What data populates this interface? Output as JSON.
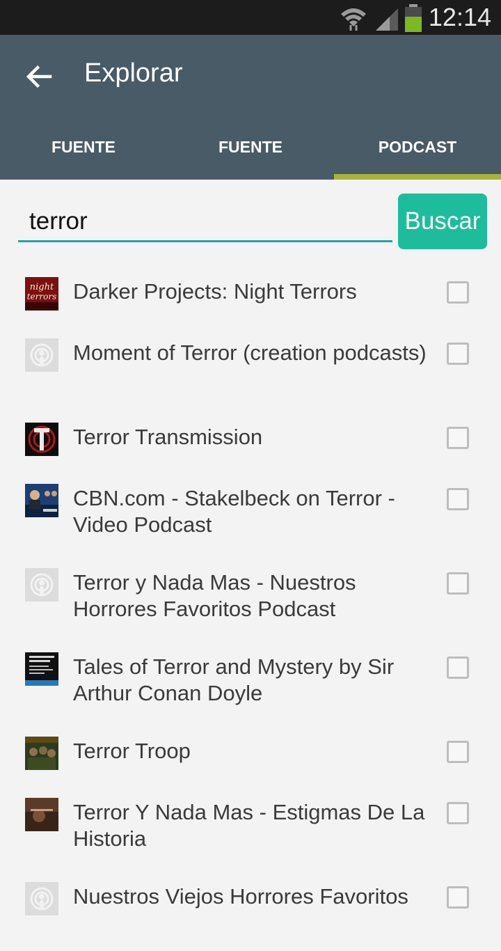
{
  "status_bar": {
    "time": "12:14"
  },
  "app_bar": {
    "title": "Explorar"
  },
  "tabs": [
    {
      "label": "FUENTE",
      "active": false
    },
    {
      "label": "FUENTE",
      "active": false
    },
    {
      "label": "PODCAST",
      "active": true
    }
  ],
  "search": {
    "value": "terror",
    "button_label": "Buscar"
  },
  "results": [
    {
      "title": "Darker Projects: Night Terrors",
      "thumb": "night-terrors-art",
      "checked": false
    },
    {
      "title": "Moment of Terror (creation podcasts)",
      "thumb": "podcast-placeholder-icon",
      "checked": false
    },
    {
      "title": "Terror Transmission",
      "thumb": "terror-transmission-art",
      "checked": false
    },
    {
      "title": "CBN.com - Stakelbeck on Terror - Video Podcast",
      "thumb": "cbn-art",
      "checked": false
    },
    {
      "title": "Terror y Nada Mas - Nuestros Horrores Favoritos Podcast",
      "thumb": "podcast-placeholder-icon",
      "checked": false
    },
    {
      "title": "Tales of Terror and Mystery by Sir Arthur Conan Doyle",
      "thumb": "tales-of-terror-art",
      "checked": false
    },
    {
      "title": "Terror Troop",
      "thumb": "terror-troop-art",
      "checked": false
    },
    {
      "title": "Terror Y Nada Mas - Estigmas De La Historia",
      "thumb": "estigmas-art",
      "checked": false
    },
    {
      "title": "Nuestros Viejos Horrores Favoritos",
      "thumb": "podcast-placeholder-icon",
      "checked": false
    }
  ],
  "colors": {
    "app_bar": "#485b67",
    "accent": "#1dbc9c",
    "tab_indicator": "#a7b43a"
  }
}
